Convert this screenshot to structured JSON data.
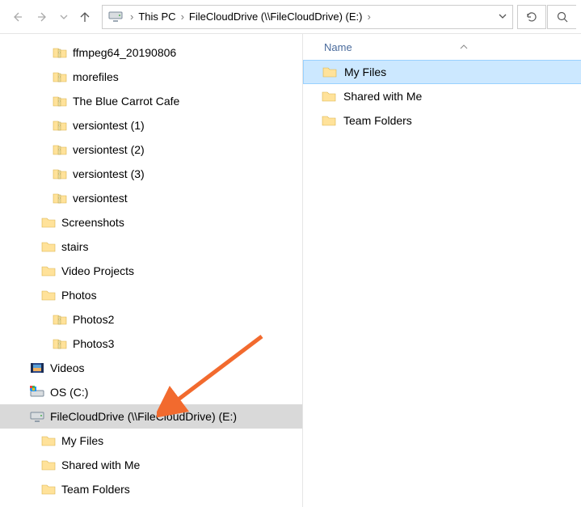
{
  "breadcrumbs": {
    "items": [
      "This PC",
      "FileCloudDrive (\\\\FileCloudDrive) (E:)"
    ]
  },
  "tree": [
    {
      "label": "ffmpeg64_20190806",
      "icon": "zip",
      "level": 3
    },
    {
      "label": "morefiles",
      "icon": "zip",
      "level": 3
    },
    {
      "label": "The Blue Carrot Cafe",
      "icon": "zip",
      "level": 3
    },
    {
      "label": "versiontest (1)",
      "icon": "zip",
      "level": 3
    },
    {
      "label": "versiontest (2)",
      "icon": "zip",
      "level": 3
    },
    {
      "label": "versiontest (3)",
      "icon": "zip",
      "level": 3
    },
    {
      "label": "versiontest",
      "icon": "zip",
      "level": 3
    },
    {
      "label": "Screenshots",
      "icon": "folder",
      "level": 2
    },
    {
      "label": "stairs",
      "icon": "folder",
      "level": 2
    },
    {
      "label": "Video Projects",
      "icon": "folder",
      "level": 2
    },
    {
      "label": "Photos",
      "icon": "folder",
      "level": 2
    },
    {
      "label": "Photos2",
      "icon": "zip",
      "level": 3
    },
    {
      "label": "Photos3",
      "icon": "zip",
      "level": 3
    },
    {
      "label": "Videos",
      "icon": "videos",
      "level": 1
    },
    {
      "label": "OS (C:)",
      "icon": "drive-os",
      "level": 1
    },
    {
      "label": "FileCloudDrive (\\\\FileCloudDrive) (E:)",
      "icon": "drive-net",
      "level": 1,
      "selected": true
    },
    {
      "label": "My Files",
      "icon": "folder",
      "level": 2
    },
    {
      "label": "Shared with Me",
      "icon": "folder",
      "level": 2
    },
    {
      "label": "Team Folders",
      "icon": "folder",
      "level": 2
    }
  ],
  "columns": {
    "name": "Name"
  },
  "files": [
    {
      "label": "My Files",
      "icon": "folder",
      "selected": true
    },
    {
      "label": "Shared with Me",
      "icon": "folder"
    },
    {
      "label": "Team Folders",
      "icon": "folder"
    }
  ],
  "colors": {
    "arrow": "#f26a2e"
  }
}
